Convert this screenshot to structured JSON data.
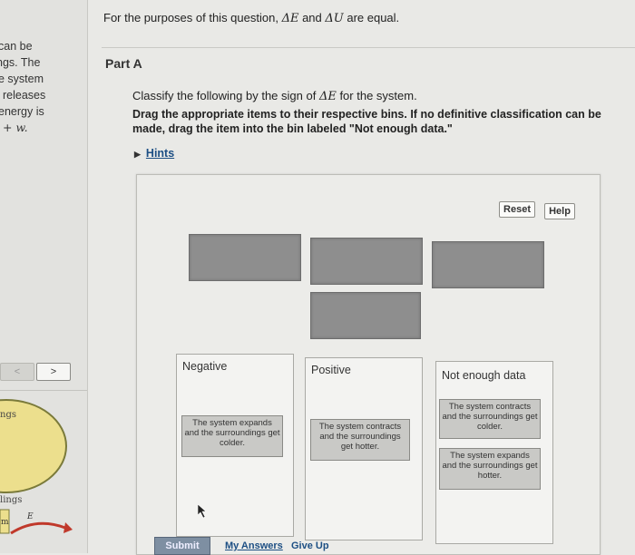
{
  "intro": {
    "text_before": "For the purposes of this question, ",
    "delta_e": "ΔE",
    "text_mid": " and ",
    "delta_u": "ΔU",
    "text_after": " are equal."
  },
  "left_panel": {
    "lines": [
      "can be",
      "ngs. The",
      "e system",
      "releases",
      "energy is",
      "+ w."
    ],
    "nav_prev": "<",
    "nav_next": ">",
    "label_ngs": "ngs",
    "label_ings": "lings",
    "diagram_letters": [
      "m",
      "E"
    ]
  },
  "part": {
    "title": "Part A",
    "classify_before": "Classify the following by the sign of ",
    "classify_symbol": "ΔE",
    "classify_after": " for the system.",
    "instruction": "Drag the appropriate items to their respective bins. If no definitive classification can be made, drag the item into the bin labeled \"Not enough data.\"",
    "hints": "Hints"
  },
  "toolbar": {
    "reset": "Reset",
    "help": "Help"
  },
  "bins": [
    {
      "label": "Negative",
      "items": [
        "The system expands and the surroundings get colder."
      ]
    },
    {
      "label": "Positive",
      "items": [
        "The system contracts and the surroundings get hotter."
      ]
    },
    {
      "label": "Not enough data",
      "items": [
        "The system contracts and the surroundings get colder.",
        "The system expands and the surroundings get hotter."
      ]
    }
  ],
  "actions": {
    "submit": "Submit",
    "my_answers": "My Answers",
    "give_up": "Give Up"
  },
  "colors": {
    "link": "#1d4f84",
    "empty_slot": "#8e8e8e",
    "card": "#c9c9c6",
    "submit_bg": "#7e8fa2",
    "ellipse_fill": "#ecdf8d"
  }
}
